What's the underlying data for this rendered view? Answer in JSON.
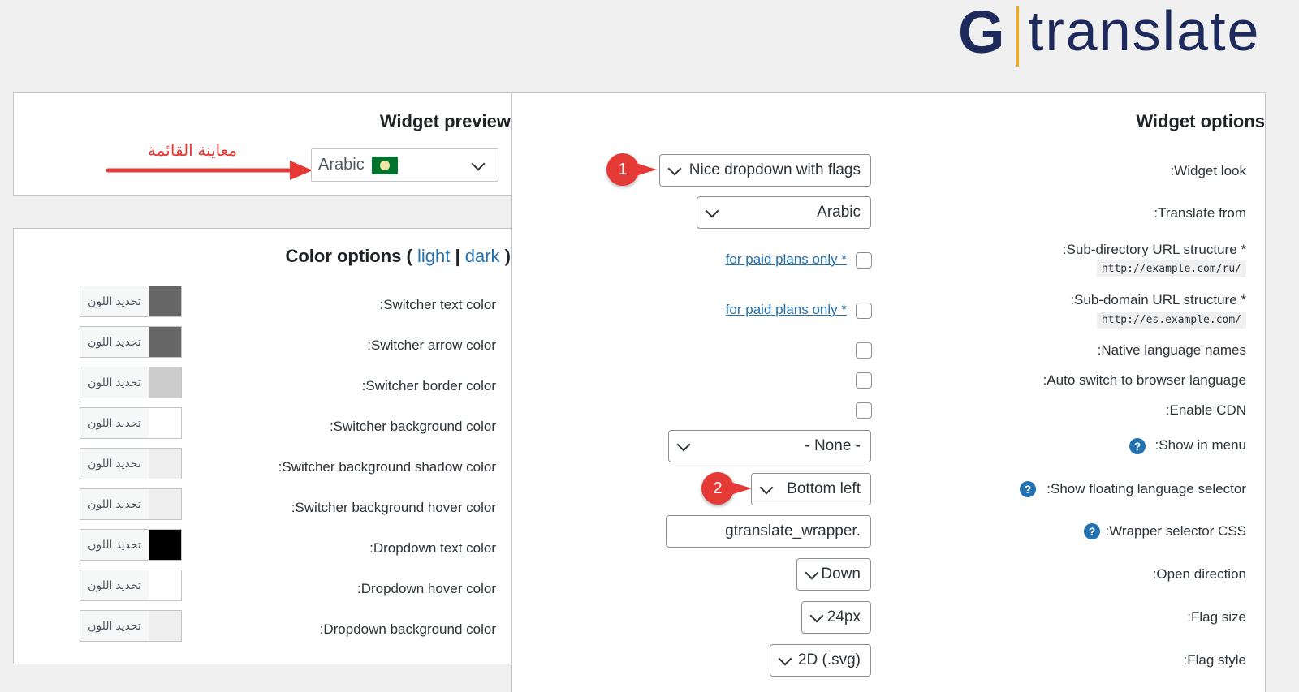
{
  "logo": {
    "mark": "G",
    "text": "translate"
  },
  "preview": {
    "heading": "Widget preview",
    "annotation": "معاينة القائمة",
    "select_value": "Arabic"
  },
  "colors": {
    "heading_prefix": "Color options (",
    "light": "light",
    "sep": "|",
    "dark": "dark",
    "heading_suffix": ")",
    "button_label": "تحديد اللون",
    "rows": [
      {
        "label": ":Switcher text color",
        "color": "#666666"
      },
      {
        "label": ":Switcher arrow color",
        "color": "#666666"
      },
      {
        "label": ":Switcher border color",
        "color": "#cccccc"
      },
      {
        "label": ":Switcher background color",
        "color": "#ffffff"
      },
      {
        "label": ":Switcher background shadow color",
        "color": "#efefef"
      },
      {
        "label": ":Switcher background hover color",
        "color": "#eeeeee"
      },
      {
        "label": ":Dropdown text color",
        "color": "#000000"
      },
      {
        "label": ":Dropdown hover color",
        "color": "#ffffff"
      },
      {
        "label": ":Dropdown background color",
        "color": "#eeeeee"
      }
    ]
  },
  "options": {
    "heading": "Widget options",
    "widget_look": {
      "label": ":Widget look",
      "value": "Nice dropdown with flags",
      "badge": "1"
    },
    "translate_from": {
      "label": ":Translate from",
      "value": "Arabic"
    },
    "subdir": {
      "label": "Sub-directory URL structure *:",
      "label_display": ":Sub-directory URL structure *",
      "code": "http://example.com/ru/",
      "link": "for paid plans only *"
    },
    "subdomain": {
      "label_display": ":Sub-domain URL structure *",
      "code": "http://es.example.com/",
      "link": "for paid plans only *"
    },
    "native_names": {
      "label": ":Native language names"
    },
    "auto_switch": {
      "label": ":Auto switch to browser language"
    },
    "cdn": {
      "label": ":Enable CDN"
    },
    "show_in_menu": {
      "label": ":Show in menu",
      "value": "- None -"
    },
    "floating": {
      "label": ":Show floating language selector",
      "value": "Bottom left",
      "badge": "2"
    },
    "wrapper": {
      "label": ":Wrapper selector CSS",
      "value": "gtranslate_wrapper."
    },
    "open_direction": {
      "label": ":Open direction",
      "value": "Down"
    },
    "flag_size": {
      "label": ":Flag size",
      "value": "24px"
    },
    "flag_style": {
      "label": ":Flag style",
      "value": "2D (.svg)"
    }
  },
  "accent": {
    "link": "#2271b1",
    "badge": "#e53935",
    "arrow": "#e53935",
    "logo": "#1f2a5c",
    "logo_bar": "#f4a81c"
  }
}
